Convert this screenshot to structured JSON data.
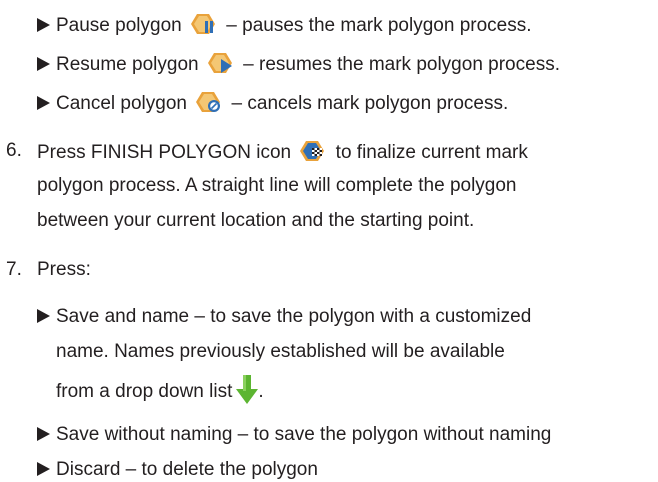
{
  "bullets_top": [
    {
      "label_before": "Pause polygon",
      "label_after": "– pauses the mark polygon process.",
      "icon": "pause-polygon-icon"
    },
    {
      "label_before": "Resume polygon",
      "label_after": "– resumes the mark polygon process.",
      "icon": "resume-polygon-icon"
    },
    {
      "label_before": "Cancel polygon",
      "label_after": "– cancels mark polygon process.",
      "icon": "cancel-polygon-icon"
    }
  ],
  "step6": {
    "number": "6.",
    "line1_before": "Press FINISH POLYGON icon",
    "line1_after": "to finalize current mark",
    "line2": "polygon process. A straight line will complete the polygon",
    "line3": "between your current location and the starting point.",
    "icon": "finish-polygon-icon"
  },
  "step7": {
    "number": "7.",
    "text": "Press:",
    "options": [
      {
        "lines": [
          "Save and name – to save the polygon with a customized",
          "name. Names previously established will be available",
          "from a drop down list"
        ],
        "trailing": ".",
        "icon": "drop-down-arrow-icon"
      },
      {
        "lines": [
          "Save without naming – to save the polygon without naming"
        ]
      },
      {
        "lines": [
          "Discard – to delete the polygon"
        ]
      }
    ]
  },
  "colors": {
    "text": "#231f20",
    "icon_orange": "#e9a23b",
    "icon_blue": "#2f6fb6",
    "arrow_green": "#5cb531"
  }
}
